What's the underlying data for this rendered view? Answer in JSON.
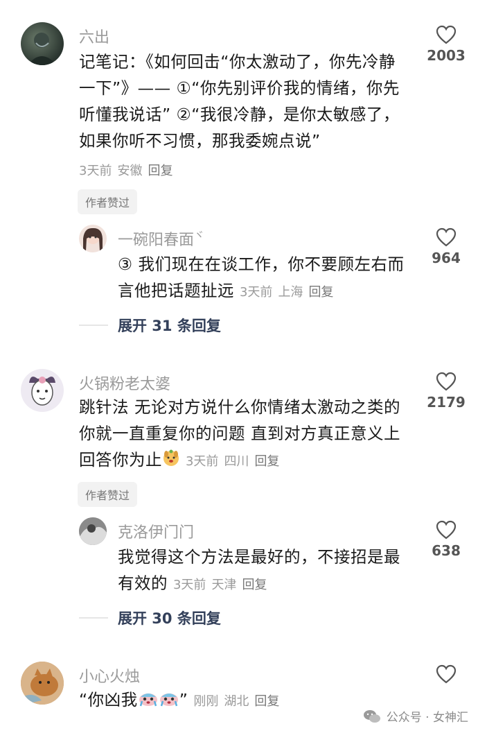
{
  "comments": [
    {
      "name": "六出",
      "text_lines": [
        "记笔记：《如何回击“你太激动了，你先冷静",
        "一下”》—— ①“你先别评价我的情绪，你先",
        "听懂我说话” ②“我很冷静，是你太敏感了，",
        "如果你听不习惯，那我委婉点说”"
      ],
      "time": "3天前",
      "location": "安徽",
      "reply_label": "回复",
      "likes": "2003",
      "badge": "作者赞过",
      "reply": {
        "name": "一碗阳春面",
        "name_suffix": "ヾ",
        "text_lines": [
          "③ 我们现在在谈工作，你不要顾左右而",
          "言他把话题扯远"
        ],
        "time": "3天前",
        "location": "上海",
        "reply_label": "回复",
        "likes": "964"
      },
      "expand_label": "展开 31 条回复"
    },
    {
      "name": "火锅粉老太婆",
      "text_lines": [
        "跳针法 无论对方说什么你情绪太激动之类的",
        "你就一直重复你的问题 直到对方真正意义上",
        "回答你为止"
      ],
      "time": "3天前",
      "location": "四川",
      "reply_label": "回复",
      "likes": "2179",
      "badge": "作者赞过",
      "reply": {
        "name": "克洛伊门门",
        "text_lines": [
          "我觉得这个方法是最好的，不接招是最",
          "有效的"
        ],
        "time": "3天前",
        "location": "天津",
        "reply_label": "回复",
        "likes": "638"
      },
      "expand_label": "展开 30 条回复"
    },
    {
      "name": "小心火烛",
      "text_open": "“你凶我",
      "text_close": "”",
      "time": "刚刚",
      "location": "湖北",
      "reply_label": "回复"
    }
  ],
  "watermark": {
    "text": "公众号 · 女神汇"
  },
  "icons": {
    "like": "heart-outline-icon",
    "emoji_dog": "puppy-emoji-icon",
    "emoji_cry": "crying-emoji-icon",
    "wechat": "wechat-icon"
  }
}
